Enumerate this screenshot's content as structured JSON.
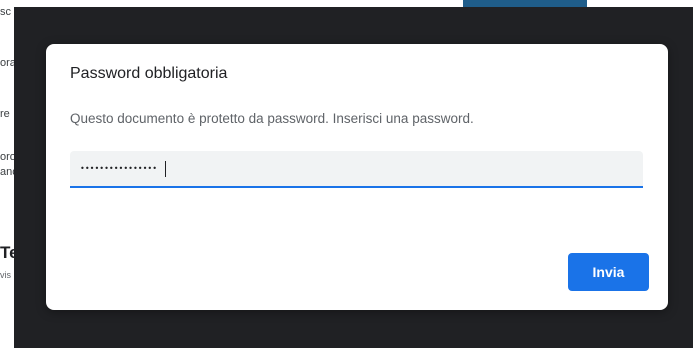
{
  "background": {
    "fragments": [
      "sc",
      "ora",
      "re",
      "oro",
      "anc"
    ],
    "heading_fragment": "Te",
    "small_fragment": "vis"
  },
  "dialog": {
    "title": "Password obbligatoria",
    "description": "Questo documento è protetto da password. Inserisci una password.",
    "password_masked_value": "••••••••••••••••",
    "submit_label": "Invia"
  },
  "colors": {
    "overlay": "#202124",
    "accent": "#1a73e8",
    "field_bg": "#f1f3f4"
  }
}
